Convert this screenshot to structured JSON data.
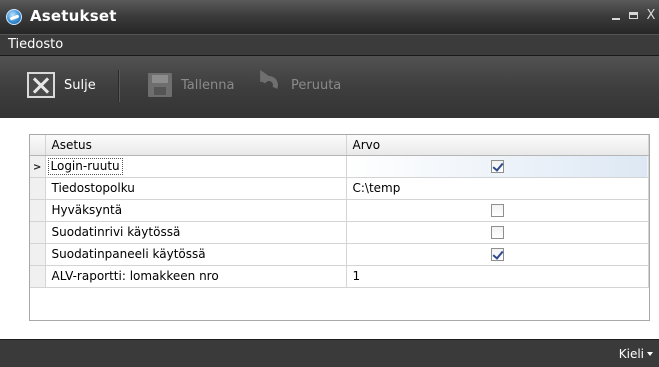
{
  "window": {
    "title": "Asetukset"
  },
  "menu": {
    "file": "Tiedosto"
  },
  "toolbar": {
    "close_label": "Sulje",
    "save_label": "Tallenna",
    "undo_label": "Peruuta"
  },
  "grid": {
    "headers": {
      "setting": "Asetus",
      "value": "Arvo"
    },
    "rows": [
      {
        "name": "Login-ruutu",
        "type": "checkbox",
        "checked": true,
        "active": true
      },
      {
        "name": "Tiedostopolku",
        "type": "text",
        "value": "C:\\temp"
      },
      {
        "name": "Hyväksyntä",
        "type": "checkbox",
        "checked": false
      },
      {
        "name": "Suodatinrivi käytössä",
        "type": "checkbox",
        "checked": false
      },
      {
        "name": "Suodatinpaneeli käytössä",
        "type": "checkbox",
        "checked": true
      },
      {
        "name": "ALV-raportti: lomakkeen nro",
        "type": "text",
        "value": "1"
      }
    ]
  },
  "statusbar": {
    "language": "Kieli"
  },
  "icons": {
    "app": "settings-app-icon",
    "close": "close-x-icon",
    "save": "save-disk-icon",
    "undo": "undo-arrow-icon",
    "row_indicator": "current-row-arrow-icon"
  }
}
